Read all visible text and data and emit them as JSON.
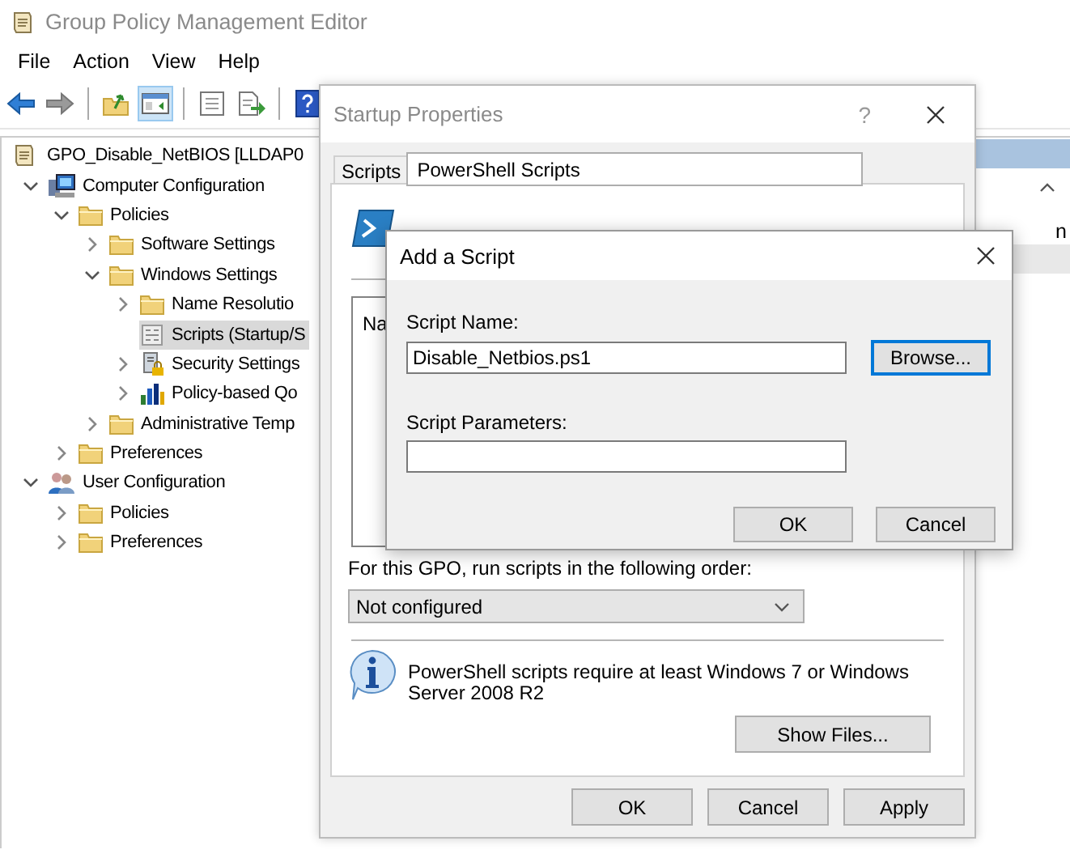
{
  "window": {
    "title": "Group Policy Management Editor"
  },
  "menu": [
    "File",
    "Action",
    "View",
    "Help"
  ],
  "toolbar": [
    {
      "buttons": [
        {
          "kind": "back",
          "on": false
        },
        {
          "kind": "forward",
          "on": false
        }
      ]
    },
    {
      "buttons": [
        {
          "kind": "folder-up",
          "on": false
        },
        {
          "kind": "pane",
          "on": true
        }
      ]
    },
    {
      "buttons": [
        {
          "kind": "list",
          "on": false
        },
        {
          "kind": "export",
          "on": false
        }
      ]
    },
    {
      "buttons": [
        {
          "kind": "help",
          "on": false
        }
      ]
    }
  ],
  "tree": [
    {
      "label": "GPO_Disable_NetBIOS [LLDAP0",
      "kind": "gpo",
      "selected": false,
      "children": [
        {
          "label": "Computer Configuration",
          "kind": "computer",
          "expanded": true,
          "selected": false,
          "children": [
            {
              "label": "Policies",
              "kind": "folder",
              "expanded": true,
              "selected": false,
              "children": [
                {
                  "label": "Software Settings",
                  "kind": "folder",
                  "expanded": false,
                  "selected": false
                },
                {
                  "label": "Windows Settings",
                  "kind": "folder",
                  "expanded": true,
                  "selected": false,
                  "children": [
                    {
                      "label": "Name Resolutio",
                      "kind": "folder",
                      "expanded": false,
                      "selected": false
                    },
                    {
                      "label": "Scripts (Startup/S",
                      "kind": "scripts",
                      "selected": true
                    },
                    {
                      "label": "Security Settings",
                      "kind": "security",
                      "expanded": false,
                      "selected": false
                    },
                    {
                      "label": "Policy-based Qo",
                      "kind": "qos",
                      "expanded": false,
                      "selected": false
                    }
                  ]
                },
                {
                  "label": "Administrative Temp",
                  "kind": "folder",
                  "expanded": false,
                  "selected": false
                }
              ]
            },
            {
              "label": "Preferences",
              "kind": "folder",
              "expanded": false,
              "selected": false
            }
          ]
        },
        {
          "label": "User Configuration",
          "kind": "user",
          "expanded": true,
          "selected": false,
          "children": [
            {
              "label": "Policies",
              "kind": "folder",
              "expanded": false,
              "selected": false
            },
            {
              "label": "Preferences",
              "kind": "folder",
              "expanded": false,
              "selected": false
            }
          ]
        }
      ]
    }
  ],
  "right_pane": {
    "text_1": "n"
  },
  "startup": {
    "title": "Startup Properties",
    "help_button": "?",
    "tabs": [
      {
        "label": "Scripts",
        "selected": false
      },
      {
        "label": "PowerShell Scripts",
        "selected": true
      }
    ],
    "list": {
      "column_1": "Na"
    },
    "order_label": "For this GPO, run scripts in the following order:",
    "order_select": {
      "value": "Not configured"
    },
    "info": "PowerShell scripts require at least Windows 7 or Windows Server 2008 R2",
    "show_files": "Show Files...",
    "buttons": [
      "OK",
      "Cancel",
      "Apply"
    ]
  },
  "add_script": {
    "title": "Add a Script",
    "name_label": "Script Name:",
    "name_value": "Disable_Netbios.ps1",
    "browse": {
      "label": "Browse...",
      "focused": true
    },
    "params_label": "Script Parameters:",
    "buttons": [
      "OK",
      "Cancel"
    ]
  }
}
